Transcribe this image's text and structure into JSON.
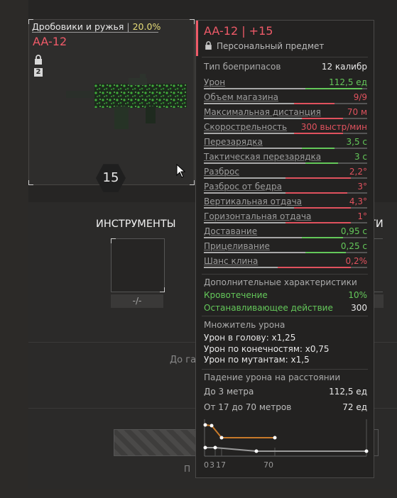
{
  "card": {
    "category": "Дробовики и ружья",
    "separator": "|",
    "percent": "20.0%",
    "name": "AA-12",
    "tier": "2",
    "level": "15"
  },
  "left": {
    "instruments_title": "ИНСТРУМЕНТЫ",
    "slot_value": "-/-",
    "right_title_fragment": "ТИ",
    "middle_text_fragment": "До га",
    "bottom_text_fragment": "П"
  },
  "tooltip": {
    "title": "AA-12 | +15",
    "subtitle": "Персональный предмет",
    "ammo_label": "Тип боеприпасов",
    "ammo_value": "12 калибр",
    "stats": [
      {
        "label": "Урон",
        "value": "112,5 ед",
        "color": "#64c85a",
        "fill": 0.62,
        "delta": 0.35
      },
      {
        "label": "Объем магазина",
        "value": "9/9",
        "color": "#e0525e",
        "fill": 0.55,
        "delta": 0.25
      },
      {
        "label": "Максимальная дистанция",
        "value": "70 м",
        "color": "#e0525e",
        "fill": 0.6,
        "delta": 0.25
      },
      {
        "label": "Скорострельность",
        "value": "300 выстр/мин",
        "color": "#e0525e",
        "fill": 0.55,
        "delta": 0.3
      },
      {
        "label": "Перезарядка",
        "value": "3,5 с",
        "color": "#64c85a",
        "fill": 0.6,
        "delta": 0.2
      },
      {
        "label": "Тактическая перезарядка",
        "value": "3 с",
        "color": "#64c85a",
        "fill": 0.62,
        "delta": 0.2
      },
      {
        "label": "Разброс",
        "value": "2,2°",
        "color": "#e0525e",
        "fill": 0.5,
        "delta": 0.4
      },
      {
        "label": "Разброс от бедра",
        "value": "3°",
        "color": "#e0525e",
        "fill": 0.5,
        "delta": 0.38
      },
      {
        "label": "Вертикальная отдача",
        "value": "4,3°",
        "color": "#e0525e",
        "fill": 0.55,
        "delta": 0.35
      },
      {
        "label": "Горизонтальная отдача",
        "value": "1°",
        "color": "#e0525e",
        "fill": 0.5,
        "delta": 0.4
      },
      {
        "label": "Доставание",
        "value": "0,95 с",
        "color": "#64c85a",
        "fill": 0.6,
        "delta": 0.25
      },
      {
        "label": "Прицеливание",
        "value": "0,25 с",
        "color": "#64c85a",
        "fill": 0.62,
        "delta": 0.25
      },
      {
        "label": "Шанс клина",
        "value": "0,2%",
        "color": "#e0525e",
        "fill": 0.45,
        "delta": 0.45
      }
    ],
    "extra_title": "Дополнительные характеристики",
    "extra": [
      {
        "label": "Кровотечение",
        "value": "10%"
      },
      {
        "label": "Останавливающее действие",
        "value": "300"
      }
    ],
    "mult_title": "Множитель урона",
    "mult": [
      "Урон в голову: x1,25",
      "Урон по конечностям: x0,75",
      "Урон по мутантам: x1,5"
    ],
    "falloff_title": "Падение урона на расстоянии",
    "falloff": [
      {
        "label": "До 3 метра",
        "value": "112,5 ед"
      },
      {
        "label": "От 17 до 70 метров",
        "value": "72 ед"
      }
    ],
    "axis_ticks": [
      "0",
      "3",
      "17",
      "70"
    ]
  },
  "colors": {
    "accent": "#ee5a68",
    "positive": "#64c85a",
    "negative": "#e0525e",
    "percent": "#e6dc78"
  }
}
